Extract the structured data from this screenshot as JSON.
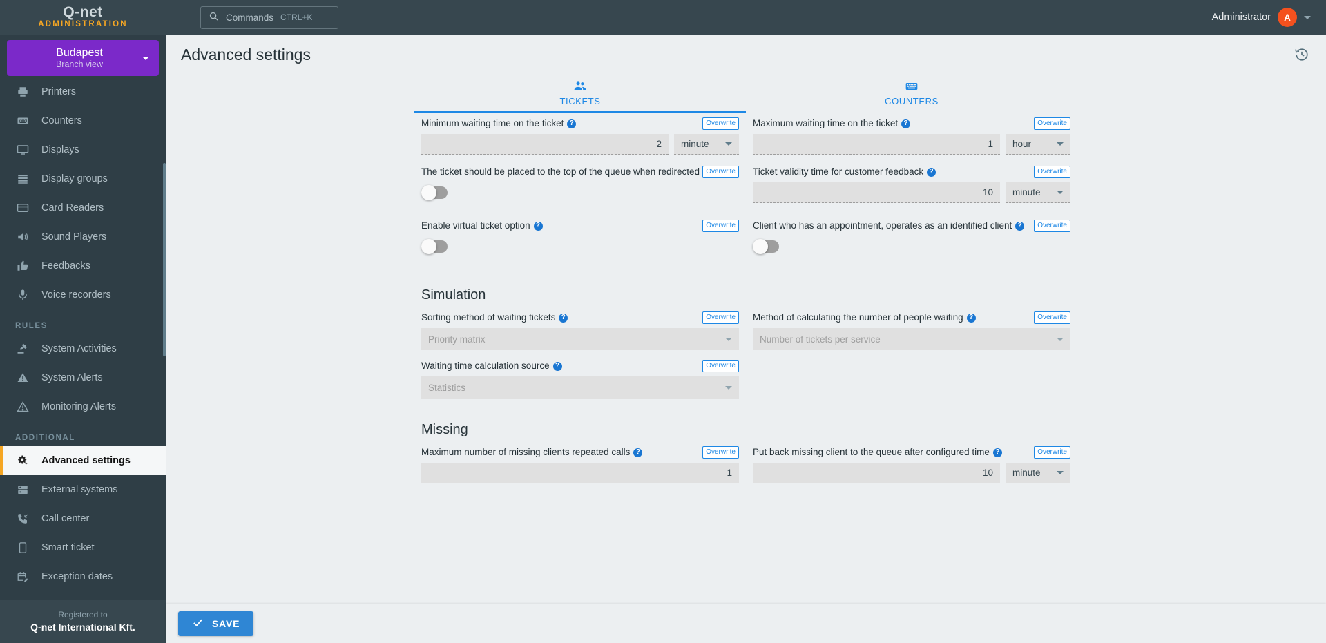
{
  "brand": {
    "logo": "Q-net",
    "sub": "ADMINISTRATION"
  },
  "topbar": {
    "commands_label": "Commands",
    "commands_shortcut": "CTRL+K",
    "user_name": "Administrator",
    "avatar_initial": "A",
    "accent": "#1e88e5",
    "brand_orange": "#f5a623",
    "avatar_color": "#f4511e"
  },
  "branch": {
    "name": "Budapest",
    "view": "Branch view",
    "color": "#7b29c9"
  },
  "sidebar": {
    "items": [
      {
        "label": "Printers",
        "icon": "printer-icon"
      },
      {
        "label": "Counters",
        "icon": "keyboard-icon"
      },
      {
        "label": "Displays",
        "icon": "monitor-icon"
      },
      {
        "label": "Display groups",
        "icon": "list-icon"
      },
      {
        "label": "Card Readers",
        "icon": "card-icon"
      },
      {
        "label": "Sound Players",
        "icon": "megaphone-icon"
      },
      {
        "label": "Feedbacks",
        "icon": "thumbs-up-icon"
      },
      {
        "label": "Voice recorders",
        "icon": "microphone-icon"
      }
    ],
    "section_rules": "RULES",
    "rules_items": [
      {
        "label": "System Activities",
        "icon": "gavel-icon"
      },
      {
        "label": "System Alerts",
        "icon": "warning-solid-icon"
      },
      {
        "label": "Monitoring Alerts",
        "icon": "warning-outline-icon"
      }
    ],
    "section_additional": "ADDITIONAL",
    "additional_items": [
      {
        "label": "Advanced settings",
        "icon": "gear-sparkle-icon",
        "active": true
      },
      {
        "label": "External systems",
        "icon": "server-icon",
        "active": false
      },
      {
        "label": "Call center",
        "icon": "phone-incoming-icon",
        "active": false
      },
      {
        "label": "Smart ticket",
        "icon": "mobile-icon",
        "active": false
      },
      {
        "label": "Exception dates",
        "icon": "calendar-edit-icon",
        "active": false
      }
    ],
    "registered_to_label": "Registered to",
    "registered_to_name": "Q-net International Kft."
  },
  "page": {
    "title": "Advanced settings",
    "history_icon": "history-icon"
  },
  "tabs": [
    {
      "label": "TICKETS",
      "icon": "people-icon",
      "active": true
    },
    {
      "label": "COUNTERS",
      "icon": "keyboard-icon",
      "active": false
    }
  ],
  "overwrite_label": "Overwrite",
  "fields": {
    "min_wait": {
      "label": "Minimum waiting time on the ticket",
      "value": "2",
      "unit": "minute"
    },
    "max_wait": {
      "label": "Maximum waiting time on the ticket",
      "value": "1",
      "unit": "hour"
    },
    "top_of_queue": {
      "label": "The ticket should be placed to the top of the queue when redirected",
      "toggle": "off"
    },
    "validity_feedback": {
      "label": "Ticket validity time for customer feedback",
      "value": "10",
      "unit": "minute"
    },
    "virtual_ticket": {
      "label": "Enable virtual ticket option",
      "toggle": "off"
    },
    "appointment_identified": {
      "label": "Client who has an appointment, operates as an identified client",
      "toggle": "off"
    }
  },
  "simulation": {
    "title": "Simulation",
    "sorting_method": {
      "label": "Sorting method of waiting tickets",
      "value": "Priority matrix"
    },
    "people_waiting_method": {
      "label": "Method of calculating the number of people waiting",
      "value": "Number of tickets per service"
    },
    "waiting_source": {
      "label": "Waiting time calculation source",
      "value": "Statistics"
    }
  },
  "missing": {
    "title": "Missing",
    "max_repeated_calls": {
      "label": "Maximum number of missing clients repeated calls",
      "value": "1"
    },
    "put_back": {
      "label": "Put back missing client to the queue after configured time",
      "value": "10",
      "unit": "minute"
    }
  },
  "footer": {
    "save_label": "SAVE",
    "save_color": "#2f86d4"
  }
}
